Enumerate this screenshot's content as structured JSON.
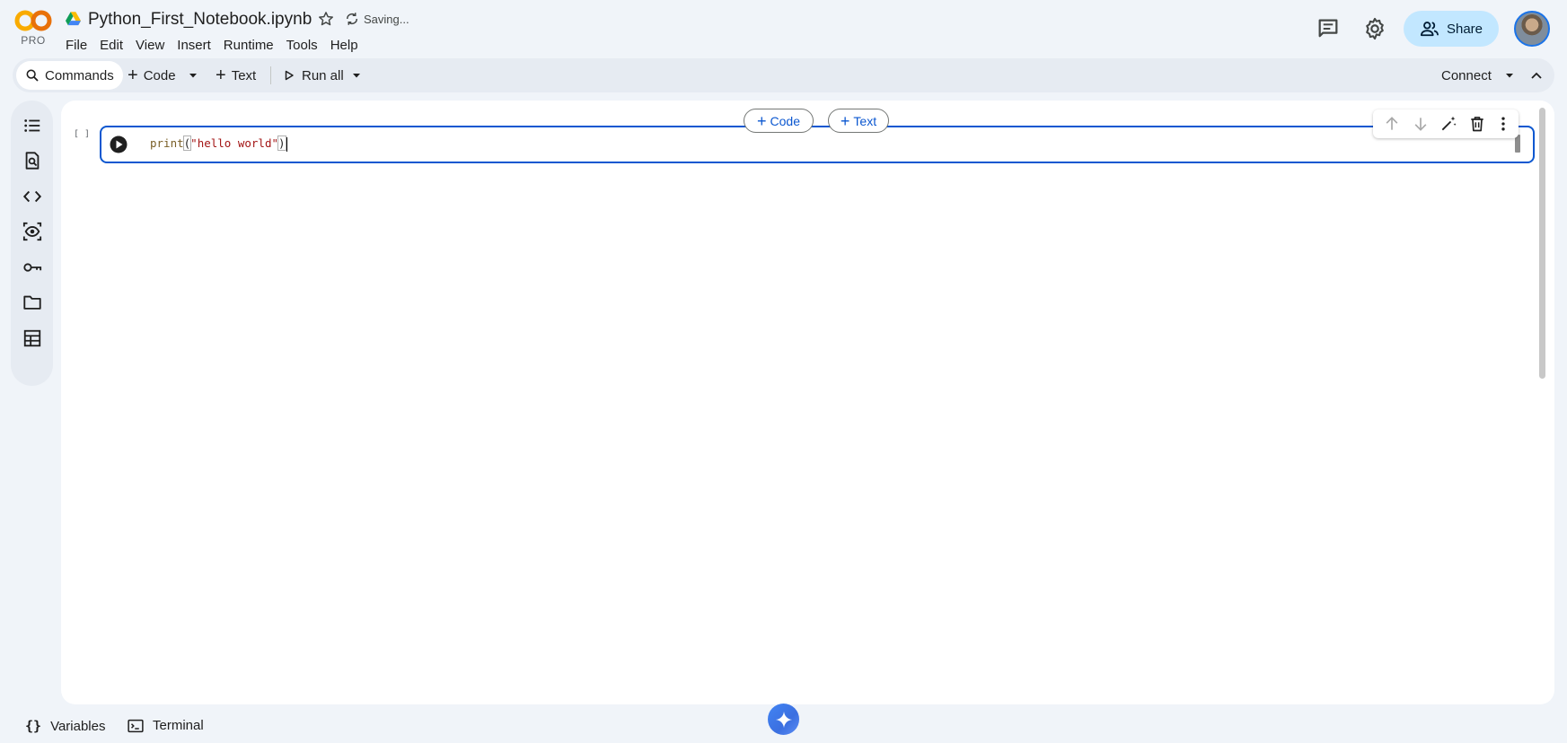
{
  "header": {
    "logo_text": "PRO",
    "title": "Python_First_Notebook.ipynb",
    "status": "Saving...",
    "menu": [
      "File",
      "Edit",
      "View",
      "Insert",
      "Runtime",
      "Tools",
      "Help"
    ],
    "share_label": "Share"
  },
  "toolbar": {
    "commands_label": "Commands",
    "code_label": "Code",
    "text_label": "Text",
    "run_all_label": "Run all",
    "connect_label": "Connect"
  },
  "sidebar": {
    "icons": [
      "table-of-contents-icon",
      "find-replace-icon",
      "code-snippets-icon",
      "variables-inspector-icon",
      "secrets-key-icon",
      "files-folder-icon",
      "data-table-icon"
    ]
  },
  "notebook": {
    "exec_count": "[ ]",
    "add_code_label": "Code",
    "add_text_label": "Text",
    "cell": {
      "code_fn": "print",
      "code_open": "(",
      "code_string": "\"hello world\"",
      "code_close": ")"
    }
  },
  "bottombar": {
    "variables_label": "Variables",
    "terminal_label": "Terminal"
  },
  "colors": {
    "accent": "#0b57d0",
    "share_bg": "#c2e7ff",
    "page_bg": "#f0f4f9"
  }
}
